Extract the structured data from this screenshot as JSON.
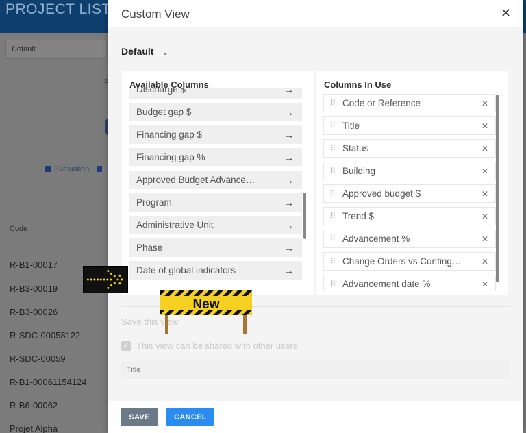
{
  "background": {
    "title": "PROJECT LIST",
    "view_select": "Default",
    "partial_text": "F",
    "legend": {
      "item1": "Evaluation"
    },
    "table": {
      "code_header": "Code",
      "rows": [
        "R-B1-00017",
        "R-B3-00019",
        "R-B3-00026",
        "R-SDC-00058122",
        "R-SDC-00059",
        "R-B1-00061154124",
        "R-B6-00062",
        "Projet Alpha"
      ]
    }
  },
  "modal": {
    "title": "Custom View",
    "close_icon": "close-icon",
    "view_selector": {
      "value": "Default",
      "icon": "chevron-down-icon"
    },
    "available": {
      "title": "Available Columns",
      "items": [
        "Discharge $",
        "Budget gap $",
        "Financing gap $",
        "Financing gap %",
        "Approved Budget Advance…",
        "Program",
        "Administrative Unit",
        "Phase",
        "Date of global indicators"
      ],
      "item_icon": "arrow-right-icon"
    },
    "in_use": {
      "title": "Columns In Use",
      "items": [
        "Code or Reference",
        "Title",
        "Status",
        "Building",
        "Approved budget $",
        "Trend $",
        "Advancement %",
        "Change Orders vs Conting…",
        "Advancement date %"
      ],
      "grip_icon": "drag-handle-icon",
      "remove_icon": "close-icon"
    },
    "save_label": "Save this view",
    "share_label": "This view can be shared with other users.",
    "share_checked": true,
    "name_placeholder": "Title",
    "buttons": {
      "save": "SAVE",
      "cancel": "CANCEL"
    }
  },
  "overlays": {
    "new_sign": "New",
    "arrow_sign_icon": "arrow-sign-icon"
  },
  "colors": {
    "header": "#0e3f6e",
    "primary_button": "#2a8cf0",
    "secondary_button": "#6b7988",
    "sign_yellow": "#f5d020"
  }
}
